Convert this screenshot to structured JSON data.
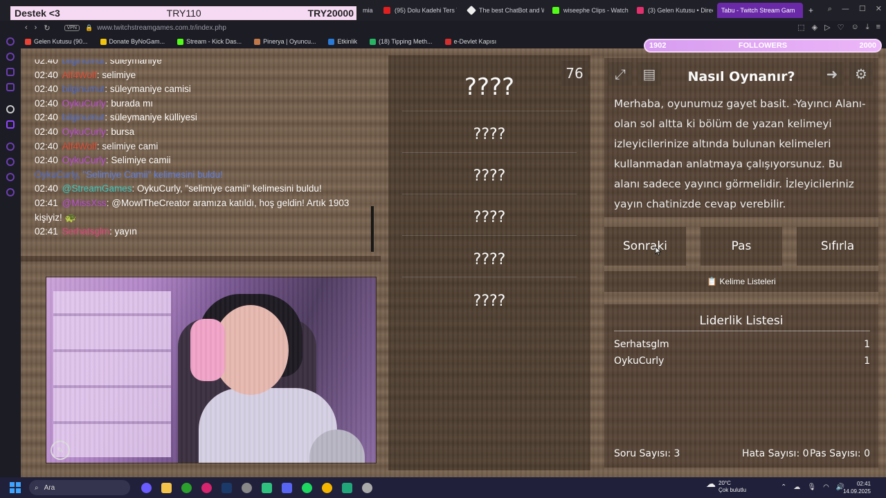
{
  "browser": {
    "donation_bar": {
      "label": "Destek <3",
      "current": "TRY110",
      "goal": "TRY20000"
    },
    "tabs": [
      {
        "title": "mia",
        "active": false
      },
      {
        "title": "(95) Dolu Kadehi Ters Tu",
        "active": false
      },
      {
        "title": "The best ChatBot and W",
        "active": false
      },
      {
        "title": "wiseephe Clips - Watch",
        "active": false
      },
      {
        "title": "(3) Gelen Kutusu • Direc",
        "active": false
      },
      {
        "title": "Tabu - Twitch Stream Gam",
        "active": true
      }
    ],
    "new_tab": "+",
    "vpn_badge": "VPN",
    "url": "www.twitchstreamgames.com.tr/index.php",
    "bookmarks": [
      {
        "label": "Gelen Kutusu (90..."
      },
      {
        "label": "Donate ByNoGam..."
      },
      {
        "label": "Stream - Kick Das..."
      },
      {
        "label": "Pinerya | Oyuncu..."
      },
      {
        "label": "Etkinlik"
      },
      {
        "label": "(18) Tipping Meth..."
      },
      {
        "label": "e-Devlet Kapısı"
      }
    ]
  },
  "followers": {
    "current": "1902",
    "label": "FOLLOWERS",
    "goal": "2000"
  },
  "chat": {
    "messages": [
      {
        "time": "02:40",
        "user": "bilginumut",
        "user_color": "#4a68c8",
        "text": ": süleymaniye"
      },
      {
        "time": "02:40",
        "user": "Alf4Wolf",
        "user_color": "#e04a32",
        "text": ": selimiye"
      },
      {
        "time": "02:40",
        "user": "bilginumut",
        "user_color": "#4a68c8",
        "text": ": süleymaniye camisi"
      },
      {
        "time": "02:40",
        "user": "OykuCurly",
        "user_color": "#b94ad8",
        "text": ": burada mı"
      },
      {
        "time": "02:40",
        "user": "bilginumut",
        "user_color": "#4a68c8",
        "text": ": süleymaniye külliyesi"
      },
      {
        "time": "02:40",
        "user": "OykuCurly",
        "user_color": "#b94ad8",
        "text": ": bursa"
      },
      {
        "time": "02:40",
        "user": "Alf4Wolf",
        "user_color": "#e04a32",
        "text": ": selimiye cami"
      },
      {
        "time": "02:40",
        "user": "OykuCurly",
        "user_color": "#b94ad8",
        "text": ": Selimiye camii"
      },
      {
        "time": "",
        "user": "OykuCurly,",
        "user_color": "#4a68c8",
        "text": " \"Selimiye Camii\" kelimesini buldu!",
        "system": true
      },
      {
        "time": "02:40",
        "user": "@StreamGames",
        "user_color": "#38c8c0",
        "text": ": OykuCurly, \"selimiye camii\" kelimesini buldu!"
      },
      {
        "time": "02:41",
        "user": "@MissXss",
        "user_color": "#b94ad8",
        "text": ": @MowlTheCreator aramıza katıldı, hoş geldin! Artık 1903"
      },
      {
        "time": "",
        "user": "",
        "user_color": "#ffffff",
        "text": "kişiyiz! 🐢"
      },
      {
        "time": "02:41",
        "user": "Serhatsglm",
        "user_color": "#e0407a",
        "text": ": yayın"
      }
    ]
  },
  "game": {
    "timer": "76",
    "main_word": "????",
    "taboo_words": [
      "????",
      "????",
      "????",
      "????",
      "????"
    ],
    "how_to": {
      "title": "Nasıl Oynanır?",
      "text": "Merhaba, oyunumuz gayet basit. -Yayıncı Alanı- olan sol altta ki bölüm de yazan kelimeyi izleyicilerinize altında bulunan kelimeleri kullanmadan anlatmaya çalışıyorsunuz. Bu alanı sadece yayıncı görmelidir. İzleyicileriniz yayın chatinizde cevap verebilir."
    },
    "buttons": {
      "next": "Sonraki",
      "pass": "Pas",
      "reset": "Sıfırla"
    },
    "word_lists_button": "📋 Kelime Listeleri",
    "leaderboard": {
      "title": "Liderlik Listesi",
      "rows": [
        {
          "name": "Serhatsglm",
          "score": "1"
        },
        {
          "name": "OykuCurly",
          "score": "1"
        }
      ]
    },
    "stats": {
      "questions": "Soru Sayısı: 3",
      "errors": "Hata Sayısı: 0",
      "passes": "Pas Sayısı: 0"
    }
  },
  "taskbar": {
    "search_placeholder": "Ara",
    "weather_temp": "20°C",
    "weather_desc": "Çok bulutlu",
    "time": "02:41",
    "date": "14.09.2025"
  }
}
